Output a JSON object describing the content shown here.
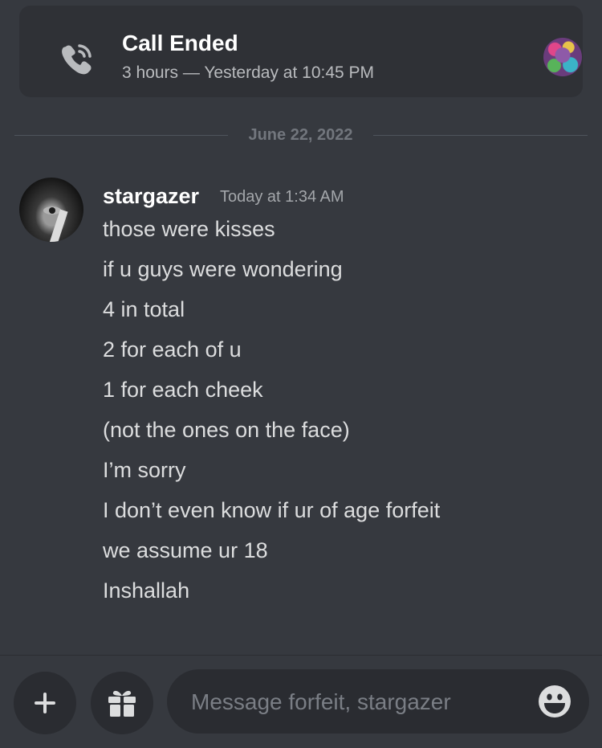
{
  "call_card": {
    "title": "Call Ended",
    "subtitle": "3 hours — Yesterday at 10:45 PM"
  },
  "date_divider": "June 22, 2022",
  "message": {
    "username": "stargazer",
    "timestamp": "Today at 1:34 AM",
    "lines": [
      "those were kisses",
      "if u guys were wondering",
      "4 in total",
      "2 for each of u",
      "1 for each cheek",
      "(not the ones on the face)",
      "I’m sorry",
      "I don’t even know if ur of age forfeit",
      "we assume ur 18",
      "Inshallah"
    ]
  },
  "composer": {
    "placeholder": "Message forfeit, stargazer"
  },
  "icons": {
    "call": "phone-call-icon",
    "plus": "plus-icon",
    "gift": "gift-icon",
    "emoji": "emoji-icon"
  },
  "colors": {
    "background": "#36393f",
    "card": "#2f3136",
    "input": "#2a2c31"
  }
}
